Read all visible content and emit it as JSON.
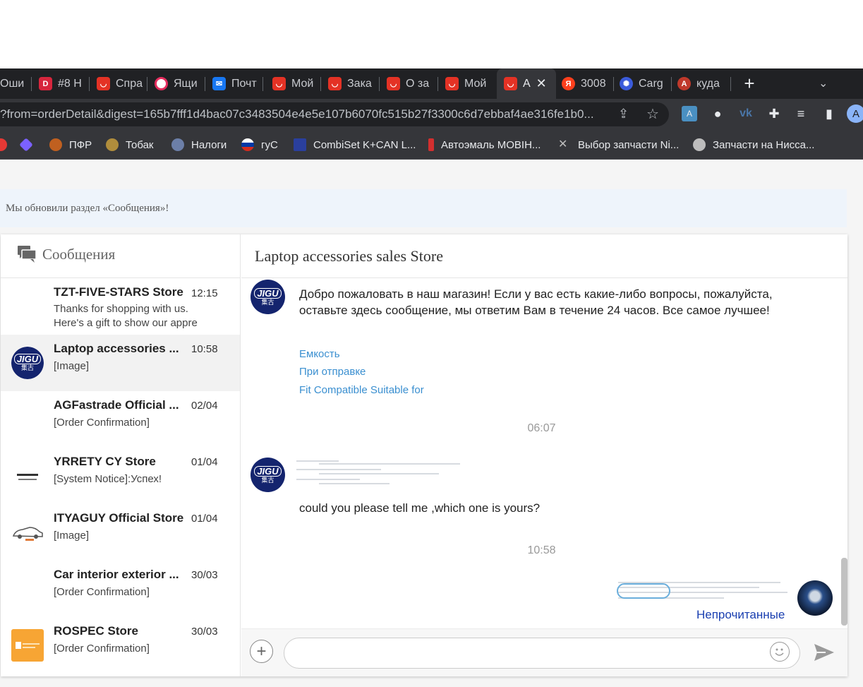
{
  "browser": {
    "tabs": [
      {
        "label": "Оши",
        "icon": "orange-tab-icon",
        "color": "#202124"
      },
      {
        "label": "#8 Н",
        "icon": "d-tab-icon",
        "color": "#d7263d"
      },
      {
        "label": "Спра",
        "icon": "aliexpress-tab-icon",
        "color": "#e43225"
      },
      {
        "label": "Ящи",
        "icon": "mail-ring-tab-icon",
        "color": "#e52d5e"
      },
      {
        "label": "Почт",
        "icon": "envelope-tab-icon",
        "color": "#1877f2"
      },
      {
        "label": "Мой",
        "icon": "aliexpress-tab-icon",
        "color": "#e43225"
      },
      {
        "label": "Зака",
        "icon": "aliexpress-tab-icon",
        "color": "#e43225"
      },
      {
        "label": "О за",
        "icon": "aliexpress-tab-icon",
        "color": "#e43225"
      },
      {
        "label": "Мой",
        "icon": "aliexpress-tab-icon",
        "color": "#e43225"
      },
      {
        "label": "А",
        "icon": "aliexpress-tab-icon",
        "color": "#e43225"
      },
      {
        "label": "3008",
        "icon": "yandex-tab-icon",
        "color": "#fc3f1d"
      },
      {
        "label": "Carg",
        "icon": "globe-tab-icon",
        "color": "#3b5bdb"
      },
      {
        "label": "куда",
        "icon": "translate-tab-icon",
        "color": "#e8eaed"
      }
    ],
    "active_tab_index": 9,
    "tab_close": "✕",
    "new_tab": "+",
    "tab_list": "⌄",
    "url": "?from=orderDetail&digest=165b7fff1d4bac07c3483504e4e5e107b6070fc515b27f3300c6d7ebbaf4ae316fe1b0...",
    "profile_letter": "A",
    "bookmarks": [
      {
        "label": "",
        "icon": "red-bookmark-icon",
        "color": "#e53935"
      },
      {
        "label": "",
        "icon": "gemini-bookmark-icon",
        "color": "#7b61ff"
      },
      {
        "label": "ПФР",
        "icon": "pfr-bookmark-icon",
        "color": "#c06020"
      },
      {
        "label": "Тобак",
        "icon": "emblem-bookmark-icon",
        "color": "#b08d3c"
      },
      {
        "label": "Налоги",
        "icon": "nalog-bookmark-icon",
        "color": "#6c7fa8"
      },
      {
        "label": "гуС",
        "icon": "flag-bookmark-icon",
        "color": "#d52b1e"
      },
      {
        "label": "CombiSet K+CAN L...",
        "icon": "combiset-bookmark-icon",
        "color": "#2a3f9d"
      },
      {
        "label": "Автоэмаль МОВІН...",
        "icon": "paint-bookmark-icon",
        "color": "#d32f2f"
      },
      {
        "label": "Выбор запчасти Ni...",
        "icon": "tools-bookmark-icon",
        "color": "#bdbdbd"
      },
      {
        "label": "Запчасти на Нисса...",
        "icon": "gear-bookmark-icon",
        "color": "#bdbdbd"
      }
    ]
  },
  "notice": "Мы обновили раздел «Сообщения»!",
  "left_panel": {
    "title": "Сообщения",
    "conversations": [
      {
        "name": "TZT-FIVE-STARS Store",
        "time": "12:15",
        "preview": "Thanks for shopping with us. Here's a gift to show our appre",
        "avatar": "none",
        "active": false
      },
      {
        "name": "Laptop accessories ...",
        "time": "10:58",
        "preview": "[Image]",
        "avatar": "jigu",
        "active": true
      },
      {
        "name": "AGFastrade Official ...",
        "time": "02/04",
        "preview": "[Order Confirmation]",
        "avatar": "none",
        "active": false
      },
      {
        "name": "YRRETY CY Store",
        "time": "01/04",
        "preview": "[System Notice]:Успех!",
        "avatar": "yrrety",
        "active": false
      },
      {
        "name": "ITYAGUY Official Store",
        "time": "01/04",
        "preview": "[Image]",
        "avatar": "car",
        "active": false
      },
      {
        "name": "Car interior exterior ...",
        "time": "30/03",
        "preview": "[Order Confirmation]",
        "avatar": "none",
        "active": false
      },
      {
        "name": "ROSPEC Store",
        "time": "30/03",
        "preview": "[Order Confirmation]",
        "avatar": "rospec",
        "active": false
      }
    ]
  },
  "chat": {
    "title": "Laptop accessories sales Store",
    "store_logo": {
      "line1": "JIGU",
      "line2": "集古"
    },
    "welcome": "Добро пожаловать в наш магазин! Если у вас есть какие-либо вопросы, пожалуйста, оставьте здесь сообщение, мы ответим Вам в течение 24 часов. Все самое лучшее!",
    "links": [
      "Емкость",
      "При отправке",
      "Fit Compatible Suitable for"
    ],
    "time1": "06:07",
    "question": "could you please tell me ,which one is yours?",
    "time2": "10:58",
    "unread_label": "Непрочитанные",
    "input_placeholder": ""
  },
  "colors": {
    "accent_link": "#3a8fd0",
    "store_navy": "#14246e",
    "rospec_orange": "#f7a534",
    "unread_blue": "#1a3fb0"
  }
}
